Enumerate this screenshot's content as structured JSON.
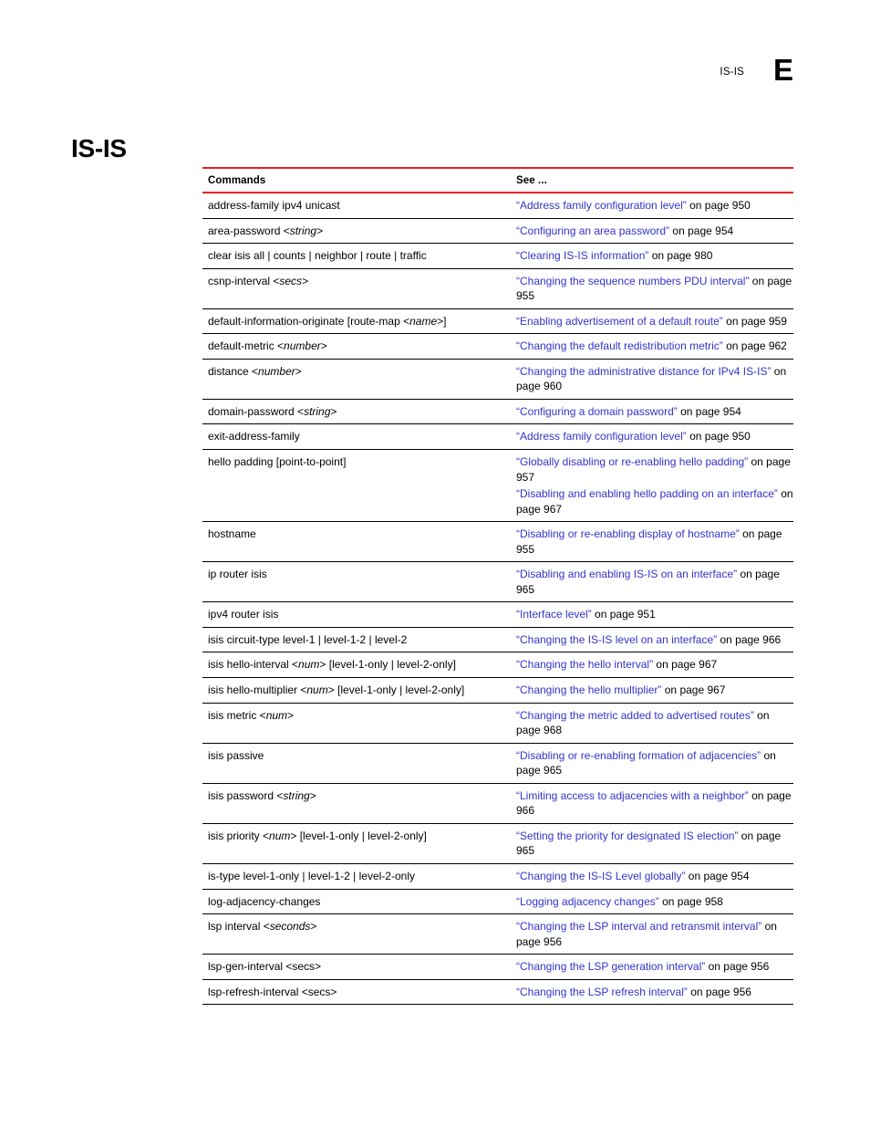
{
  "header": {
    "chapter_name": "IS-IS",
    "chapter_letter": "E"
  },
  "page_title": "IS-IS",
  "table": {
    "columns": {
      "commands": "Commands",
      "see": "See ..."
    },
    "rows": [
      {
        "command_plain": "address-family ipv4 unicast",
        "command_html": "address-family ipv4 unicast",
        "refs": [
          {
            "link": "“Address family configuration level”",
            "tail": " on page 950"
          }
        ]
      },
      {
        "command_plain": "area-password <string>",
        "command_html": "area-password &lt;<i>string</i>&gt;",
        "refs": [
          {
            "link": "“Configuring an area password”",
            "tail": " on page 954"
          }
        ]
      },
      {
        "command_plain": "clear isis all | counts | neighbor | route | traffic",
        "command_html": "clear isis all | counts | neighbor | route | traffic",
        "refs": [
          {
            "link": "“Clearing IS-IS information”",
            "tail": " on page 980"
          }
        ]
      },
      {
        "command_plain": "csnp-interval <secs>",
        "command_html": "csnp-interval &lt;<i>secs</i>&gt;",
        "refs": [
          {
            "link": "“Changing the sequence numbers PDU interval”",
            "tail": " on page 955"
          }
        ]
      },
      {
        "command_plain": "default-information-originate [route-map <name>]",
        "command_html": "default-information-originate [route-map &lt;<i>name</i>&gt;]",
        "refs": [
          {
            "link": "“Enabling advertisement of a default route”",
            "tail": " on page 959"
          }
        ]
      },
      {
        "command_plain": "default-metric <number>",
        "command_html": "default-metric &lt;<i>number</i>&gt;",
        "refs": [
          {
            "link": "“Changing the default redistribution metric”",
            "tail": " on page 962"
          }
        ]
      },
      {
        "command_plain": "distance <number>",
        "command_html": "distance &lt;<i>number</i>&gt;",
        "refs": [
          {
            "link": "“Changing the administrative distance for IPv4 IS-IS”",
            "tail": " on page 960"
          }
        ]
      },
      {
        "command_plain": "domain-password <string>",
        "command_html": "domain-password &lt;<i>string</i>&gt;",
        "refs": [
          {
            "link": "“Configuring a domain password”",
            "tail": " on page 954"
          }
        ]
      },
      {
        "command_plain": "exit-address-family",
        "command_html": "exit-address-family",
        "refs": [
          {
            "link": "“Address family configuration level”",
            "tail": " on page 950"
          }
        ]
      },
      {
        "command_plain": "hello padding [point-to-point]",
        "command_html": "hello padding [point-to-point]",
        "refs": [
          {
            "link": "“Globally disabling or re-enabling hello padding”",
            "tail": " on page 957"
          },
          {
            "link": "“Disabling and enabling hello padding on an interface”",
            "tail": " on page 967"
          }
        ]
      },
      {
        "command_plain": "hostname",
        "command_html": "hostname",
        "refs": [
          {
            "link": "“Disabling or re-enabling display of hostname”",
            "tail": " on page 955"
          }
        ]
      },
      {
        "command_plain": "ip router isis",
        "command_html": "ip router isis",
        "refs": [
          {
            "link": "“Disabling and enabling IS-IS on an interface”",
            "tail": " on page 965"
          }
        ]
      },
      {
        "command_plain": "ipv4 router isis",
        "command_html": "ipv4 router isis",
        "refs": [
          {
            "link": "“Interface level”",
            "tail": " on page 951"
          }
        ]
      },
      {
        "command_plain": "isis circuit-type level-1 | level-1-2 | level-2",
        "command_html": "isis circuit-type level-1 | level-1-2 | level-2",
        "refs": [
          {
            "link": "“Changing the IS-IS level on an interface”",
            "tail": " on page 966"
          }
        ]
      },
      {
        "command_plain": "isis hello-interval <num> [level-1-only | level-2-only]",
        "command_html": "isis hello-interval &lt;<i>num</i>&gt; [level-1-only | level-2-only]",
        "refs": [
          {
            "link": "“Changing the hello interval”",
            "tail": " on page 967"
          }
        ]
      },
      {
        "command_plain": "isis hello-multiplier <num> [level-1-only | level-2-only]",
        "command_html": "isis hello-multiplier &lt;<i>num</i>&gt; [level-1-only | level-2-only]",
        "refs": [
          {
            "link": "“Changing the hello multiplier”",
            "tail": " on page 967"
          }
        ]
      },
      {
        "command_plain": "isis metric <num>",
        "command_html": "isis metric &lt;<i>num</i>&gt;",
        "refs": [
          {
            "link": "“Changing the metric added to advertised routes”",
            "tail": " on page 968"
          }
        ]
      },
      {
        "command_plain": "isis passive",
        "command_html": "isis passive",
        "refs": [
          {
            "link": "“Disabling or re-enabling formation of adjacencies”",
            "tail": " on page 965"
          }
        ]
      },
      {
        "command_plain": "isis password <string>",
        "command_html": "isis password &lt;<i>string</i>&gt;",
        "refs": [
          {
            "link": "“Limiting access to adjacencies with a neighbor”",
            "tail": " on page 966"
          }
        ]
      },
      {
        "command_plain": "isis priority <num> [level-1-only | level-2-only]",
        "command_html": "isis priority &lt;<i>num</i>&gt; [level-1-only | level-2-only]",
        "refs": [
          {
            "link": "“Setting the priority for designated IS election”",
            "tail": " on page 965"
          }
        ]
      },
      {
        "command_plain": "is-type level-1-only | level-1-2 | level-2-only",
        "command_html": "is-type level-1-only | level-1-2 | level-2-only",
        "refs": [
          {
            "link": "“Changing the IS-IS Level globally”",
            "tail": " on page 954"
          }
        ]
      },
      {
        "command_plain": "log-adjacency-changes",
        "command_html": "log-adjacency-changes",
        "refs": [
          {
            "link": "“Logging adjacency changes”",
            "tail": " on page 958"
          }
        ]
      },
      {
        "command_plain": "lsp interval <seconds>",
        "command_html": "lsp interval &lt;<i>seconds</i>&gt;",
        "refs": [
          {
            "link": "“Changing the LSP interval and retransmit interval”",
            "tail": " on page 956"
          }
        ]
      },
      {
        "command_plain": "lsp-gen-interval <secs>",
        "command_html": "lsp-gen-interval &lt;secs&gt;",
        "refs": [
          {
            "link": "“Changing the LSP generation interval”",
            "tail": " on page 956"
          }
        ]
      },
      {
        "command_plain": "lsp-refresh-interval <secs>",
        "command_html": "lsp-refresh-interval &lt;secs&gt;",
        "refs": [
          {
            "link": "“Changing the LSP refresh interval”",
            "tail": " on page 956"
          }
        ]
      }
    ]
  },
  "colors": {
    "rule_red": "#ED1C24",
    "link_blue": "#3333CC",
    "text_black": "#000000"
  }
}
